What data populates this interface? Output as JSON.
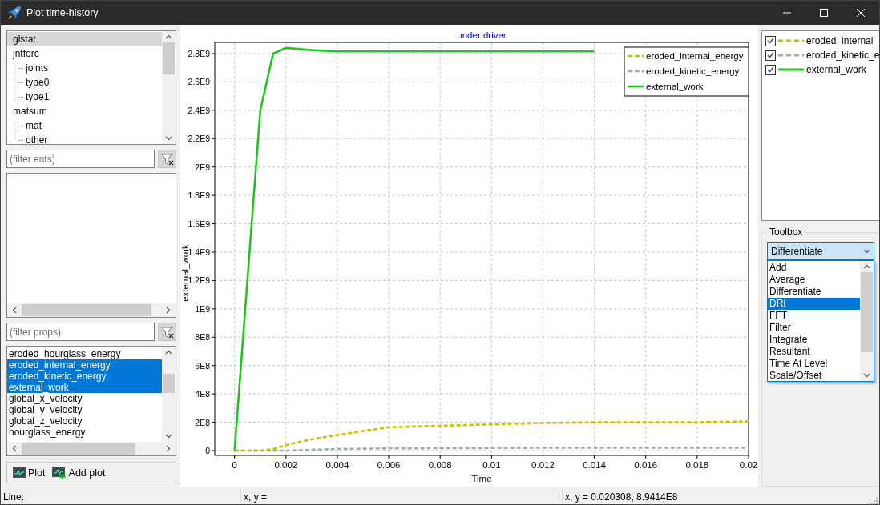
{
  "window": {
    "title": "Plot time-history"
  },
  "tree": [
    {
      "label": "glstat",
      "selected": true
    },
    {
      "label": "jntforc",
      "selected": false,
      "children": [
        {
          "label": "joints",
          "selected": false
        },
        {
          "label": "type0",
          "selected": false
        },
        {
          "label": "type1",
          "selected": false
        }
      ]
    },
    {
      "label": "matsum",
      "selected": false,
      "children": [
        {
          "label": "mat",
          "selected": false
        },
        {
          "label": "other",
          "selected": false
        }
      ]
    }
  ],
  "ents_filter": {
    "placeholder": "(filter ents)"
  },
  "props_filter": {
    "placeholder": "(filter props)"
  },
  "props": [
    {
      "label": "eroded_hourglass_energy",
      "selected": false
    },
    {
      "label": "eroded_internal_energy",
      "selected": true
    },
    {
      "label": "eroded_kinetic_energy",
      "selected": true
    },
    {
      "label": "external_work",
      "selected": true
    },
    {
      "label": "global_x_velocity",
      "selected": false
    },
    {
      "label": "global_y_velocity",
      "selected": false
    },
    {
      "label": "global_z_velocity",
      "selected": false
    },
    {
      "label": "hourglass_energy",
      "selected": false
    }
  ],
  "buttons": [
    {
      "label": "Plot",
      "kind": "plot"
    },
    {
      "label": "Add plot",
      "kind": "add"
    }
  ],
  "chart": {
    "chart_data": {
      "type": "line",
      "title": "under driver",
      "xlabel": "Time",
      "ylabel": "external_work",
      "x": [
        0,
        0.0005,
        0.001,
        0.0015,
        0.002,
        0.003,
        0.004,
        0.006,
        0.008,
        0.01,
        0.012,
        0.014,
        0.016,
        0.018,
        0.02
      ],
      "series": [
        {
          "name": "eroded_internal_energy",
          "color": "#c2c200",
          "line_style": "dashed",
          "values": [
            0,
            0,
            0,
            10000000,
            40000000,
            80000000,
            110000000,
            165000000,
            175000000,
            185000000,
            195000000,
            200000000,
            200000000,
            200000000,
            206000000
          ]
        },
        {
          "name": "eroded_kinetic_energy",
          "color": "#99b399",
          "line_style": "dashed",
          "values": [
            0,
            0,
            0,
            0,
            0,
            5000000,
            12000000,
            15000000,
            17000000,
            18000000,
            20000000,
            20000000,
            20000000,
            20000000,
            20000000
          ]
        },
        {
          "name": "external_work",
          "color": "#22c422",
          "line_style": "solid",
          "values": [
            0,
            1200000000,
            2400000000,
            2800000000,
            2840000000,
            2825000000,
            2815000000,
            2815000000,
            2815000000,
            2815000000,
            2815000000,
            2815000000,
            null,
            null,
            null
          ]
        }
      ],
      "grid": true,
      "legend": true,
      "xlim": [
        -0.00077,
        0.02
      ],
      "ylim": [
        -33900000,
        2879000000
      ],
      "xticks": [
        {
          "value": 0,
          "label": "0"
        },
        {
          "value": 0.002,
          "label": "0.002"
        },
        {
          "value": 0.004,
          "label": "0.004"
        },
        {
          "value": 0.006,
          "label": "0.006"
        },
        {
          "value": 0.008,
          "label": "0.008"
        },
        {
          "value": 0.01,
          "label": "0.01"
        },
        {
          "value": 0.012,
          "label": "0.012"
        },
        {
          "value": 0.014,
          "label": "0.014"
        },
        {
          "value": 0.016,
          "label": "0.016"
        },
        {
          "value": 0.018,
          "label": "0.018"
        },
        {
          "value": 0.02,
          "label": "0.02"
        }
      ],
      "yticks": [
        {
          "value": 0,
          "label": "0"
        },
        {
          "value": 200000000,
          "label": "2E8"
        },
        {
          "value": 400000000,
          "label": "4E8"
        },
        {
          "value": 600000000,
          "label": "6E8"
        },
        {
          "value": 800000000,
          "label": "8E8"
        },
        {
          "value": 1000000000,
          "label": "1E9"
        },
        {
          "value": 1200000000,
          "label": "1.2E9"
        },
        {
          "value": 1400000000,
          "label": "1.4E9"
        },
        {
          "value": 1600000000,
          "label": "1.6E9"
        },
        {
          "value": 1800000000,
          "label": "1.8E9"
        },
        {
          "value": 2000000000,
          "label": "2E9"
        },
        {
          "value": 2200000000,
          "label": "2.2E9"
        },
        {
          "value": 2400000000,
          "label": "2.4E9"
        },
        {
          "value": 2600000000,
          "label": "2.6E9"
        },
        {
          "value": 2800000000,
          "label": "2.8E9"
        }
      ]
    }
  },
  "curves": [
    {
      "label": "eroded_internal_",
      "checked": true,
      "color": "#c2c200",
      "kind": "dashed"
    },
    {
      "label": "eroded_kinetic_e",
      "checked": true,
      "color": "#99b399",
      "kind": "dashed"
    },
    {
      "label": "external_work",
      "checked": true,
      "color": "#22c422",
      "kind": "solid"
    }
  ],
  "toolbox": {
    "title": "Toolbox",
    "combo": {
      "value": "Differentiate",
      "expanded": true
    },
    "options": [
      {
        "label": "Add",
        "selected": false
      },
      {
        "label": "Average",
        "selected": false
      },
      {
        "label": "Differentiate",
        "selected": false
      },
      {
        "label": "DRI",
        "selected": true
      },
      {
        "label": "FFT",
        "selected": false
      },
      {
        "label": "Filter",
        "selected": false
      },
      {
        "label": "Integrate",
        "selected": false
      },
      {
        "label": "Resultant",
        "selected": false
      },
      {
        "label": "Time At Level",
        "selected": false
      },
      {
        "label": "Scale/Offset",
        "selected": false
      }
    ]
  },
  "status_bar": [
    "Line:",
    "x, y =",
    "x, y = 0.020308, 8.9414E8"
  ]
}
